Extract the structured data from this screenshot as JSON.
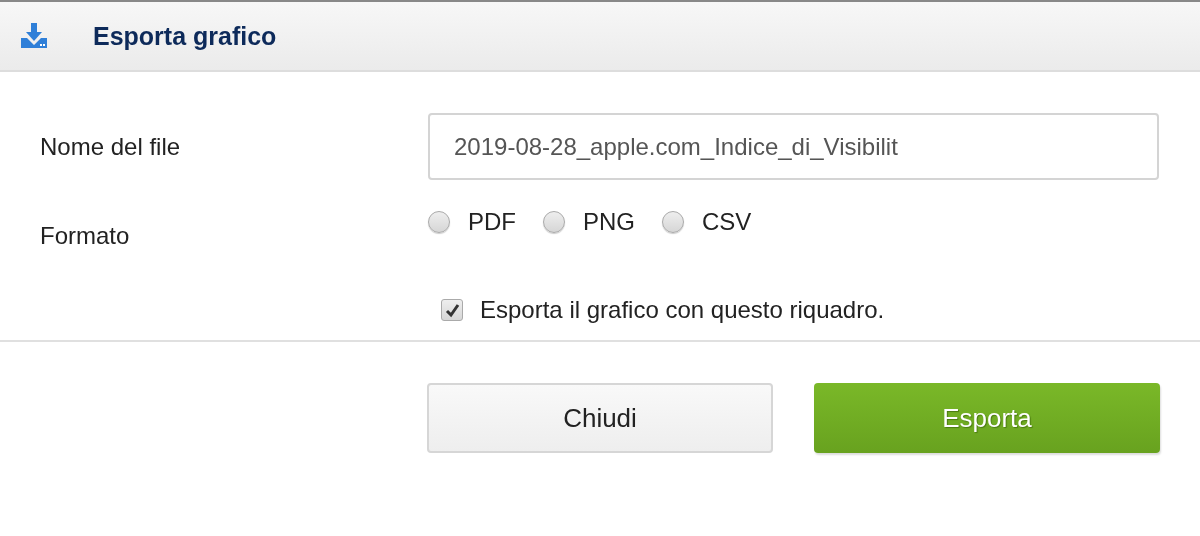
{
  "dialog": {
    "title": "Esporta grafico"
  },
  "fields": [
    {
      "kind": "text",
      "label": "Nome del file",
      "value": "2019-08-28_apple.com_Indice_di_Visibilit"
    },
    {
      "kind": "radio",
      "label": "Formato",
      "options": [
        {
          "label": "PDF",
          "selected": false
        },
        {
          "label": "PNG",
          "selected": false
        },
        {
          "label": "CSV",
          "selected": false
        }
      ]
    }
  ],
  "checkbox": {
    "label": "Esporta il grafico con questo riquadro.",
    "checked": true
  },
  "buttons": [
    {
      "label": "Chiudi",
      "kind": "secondary"
    },
    {
      "label": "Esporta",
      "kind": "primary"
    }
  ]
}
